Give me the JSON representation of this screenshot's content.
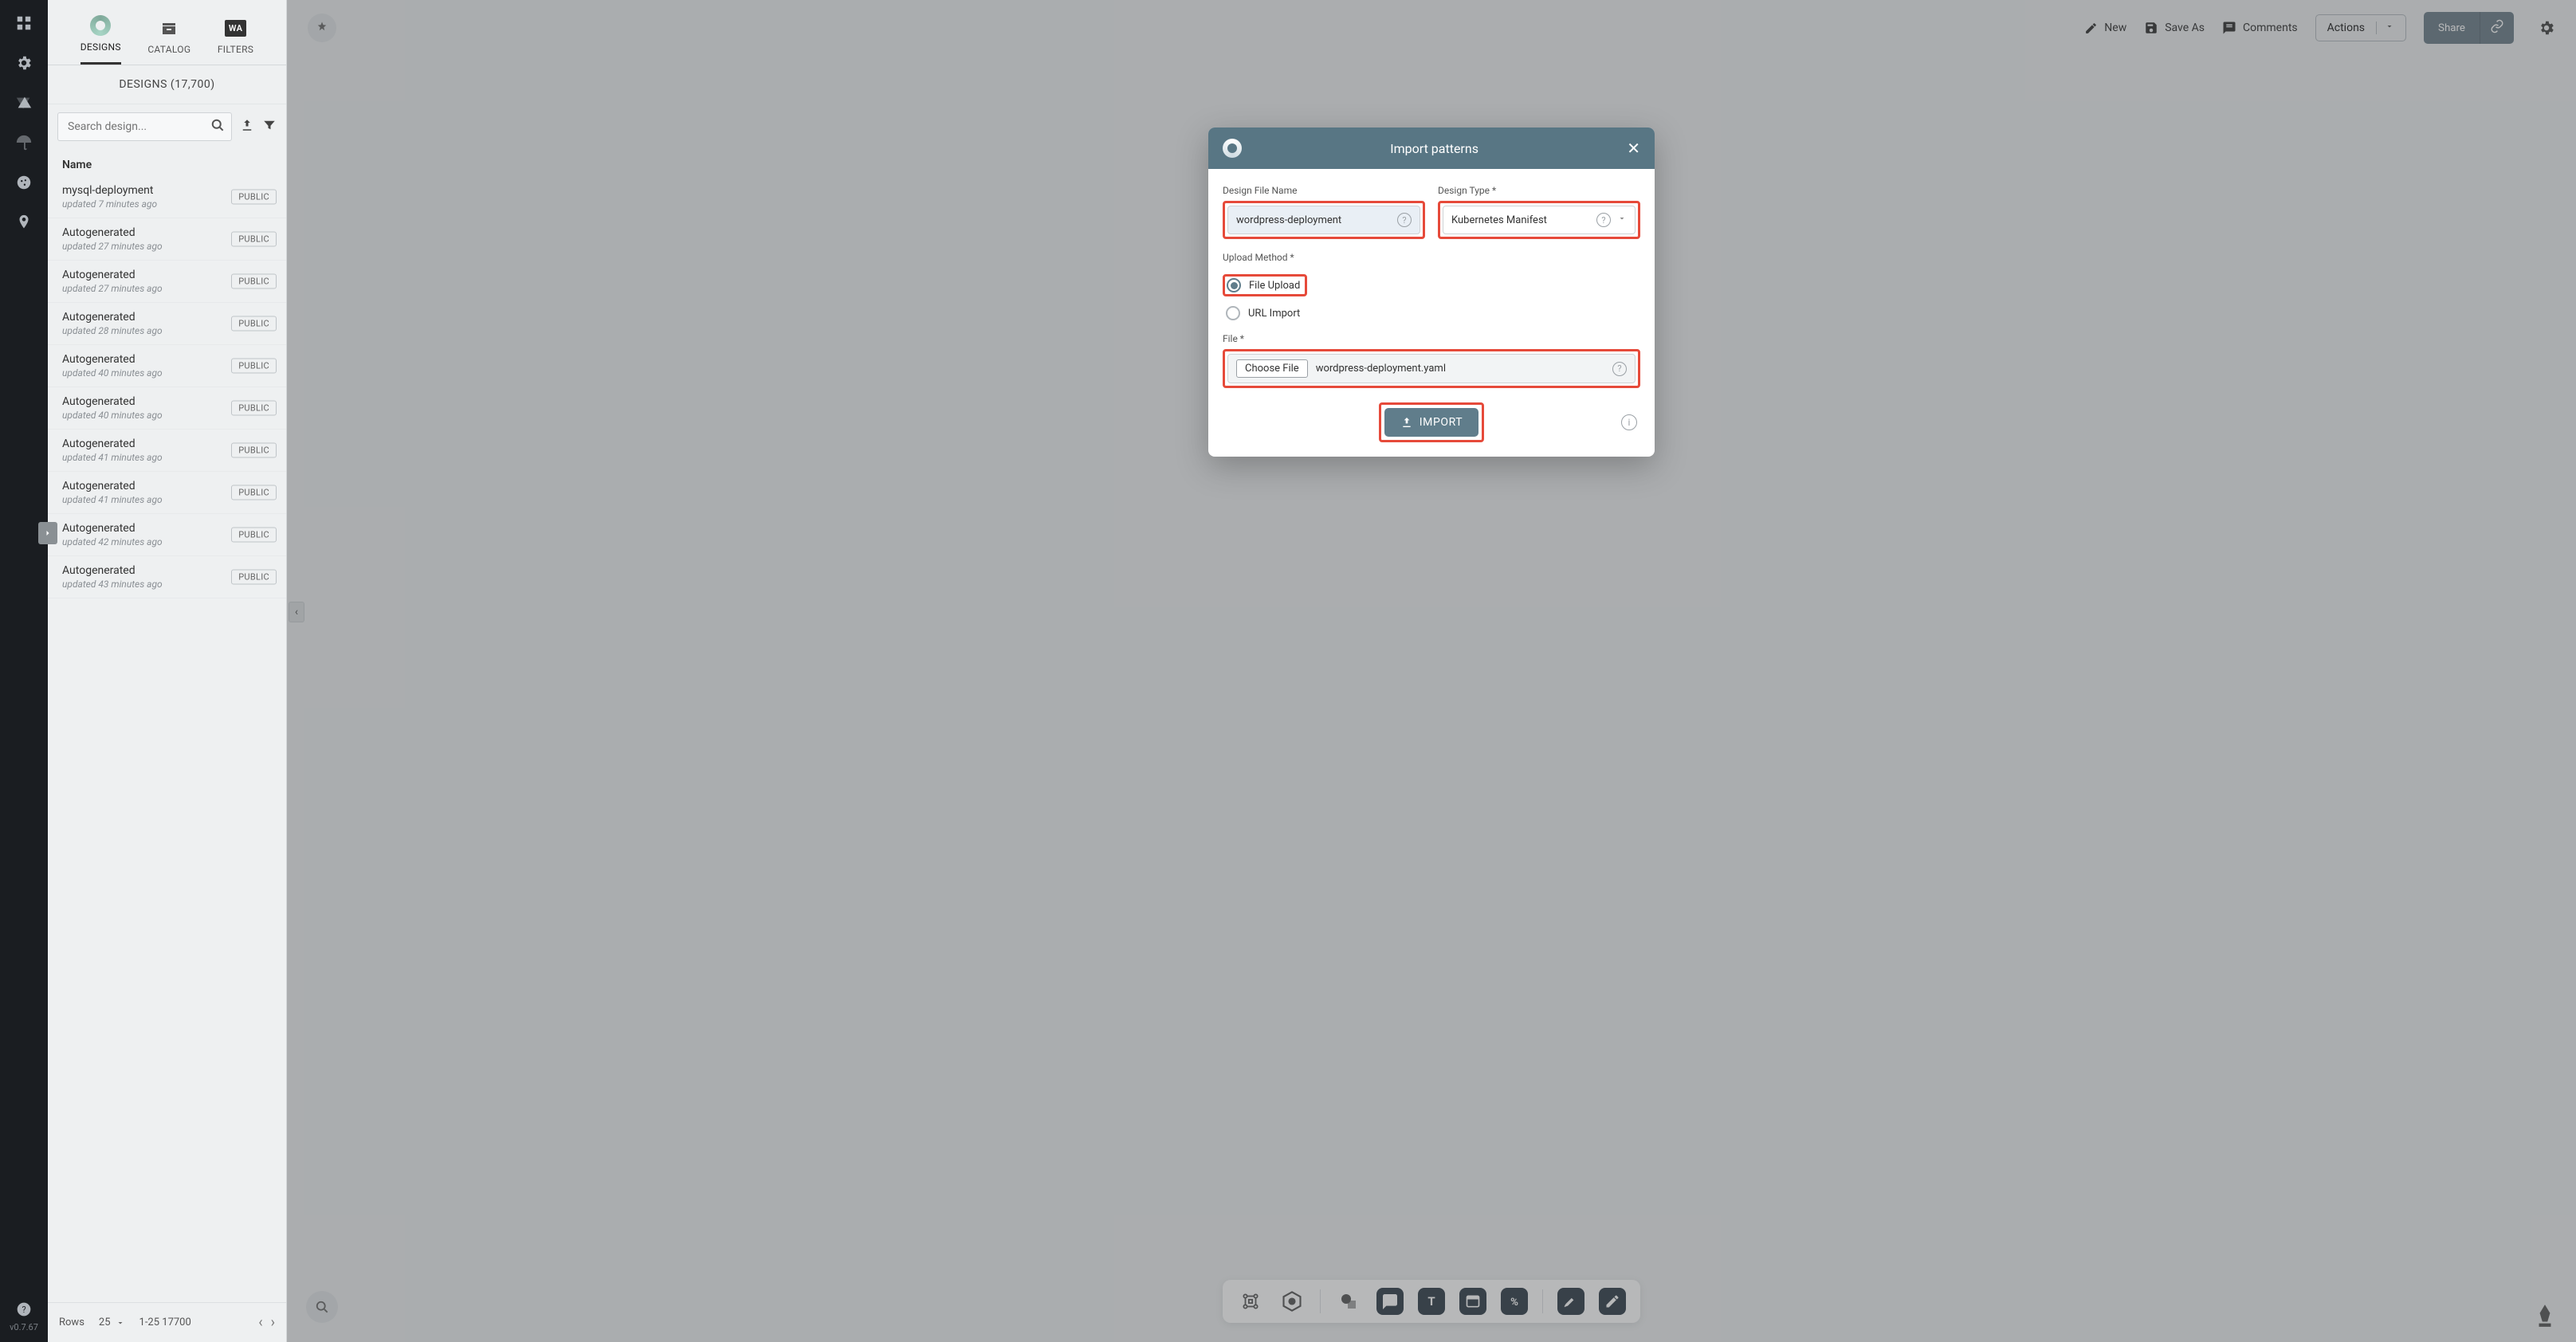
{
  "rail": {
    "version": "v0.7.67"
  },
  "sidebar": {
    "tabs": {
      "designs": "DESIGNS",
      "catalog": "CATALOG",
      "filters": "FILTERS",
      "wa": "WA"
    },
    "countHeader": "DESIGNS (17,700)",
    "searchPlaceholder": "Search design...",
    "nameHeader": "Name",
    "items": [
      {
        "name": "mysql-deployment",
        "meta": "updated 7 minutes ago",
        "badge": "PUBLIC"
      },
      {
        "name": "Autogenerated",
        "meta": "updated 27 minutes ago",
        "badge": "PUBLIC"
      },
      {
        "name": "Autogenerated",
        "meta": "updated 27 minutes ago",
        "badge": "PUBLIC"
      },
      {
        "name": "Autogenerated",
        "meta": "updated 28 minutes ago",
        "badge": "PUBLIC"
      },
      {
        "name": "Autogenerated",
        "meta": "updated 40 minutes ago",
        "badge": "PUBLIC"
      },
      {
        "name": "Autogenerated",
        "meta": "updated 40 minutes ago",
        "badge": "PUBLIC"
      },
      {
        "name": "Autogenerated",
        "meta": "updated 41 minutes ago",
        "badge": "PUBLIC"
      },
      {
        "name": "Autogenerated",
        "meta": "updated 41 minutes ago",
        "badge": "PUBLIC"
      },
      {
        "name": "Autogenerated",
        "meta": "updated 42 minutes ago",
        "badge": "PUBLIC"
      },
      {
        "name": "Autogenerated",
        "meta": "updated 43 minutes ago",
        "badge": "PUBLIC"
      }
    ],
    "footer": {
      "rowsLabel": "Rows",
      "rowsValue": "25",
      "range": "1-25 17700"
    }
  },
  "topbar": {
    "new": "New",
    "saveAs": "Save As",
    "comments": "Comments",
    "actions": "Actions",
    "share": "Share"
  },
  "modal": {
    "title": "Import patterns",
    "fields": {
      "fileNameLabel": "Design File Name",
      "fileNameValue": "wordpress-deployment",
      "typeLabel": "Design Type *",
      "typeValue": "Kubernetes Manifest",
      "uploadMethodLabel": "Upload Method *",
      "optFile": "File Upload",
      "optUrl": "URL Import",
      "fileLabel": "File *",
      "chooseFile": "Choose File",
      "fileName": "wordpress-deployment.yaml"
    },
    "importBtn": "IMPORT"
  }
}
